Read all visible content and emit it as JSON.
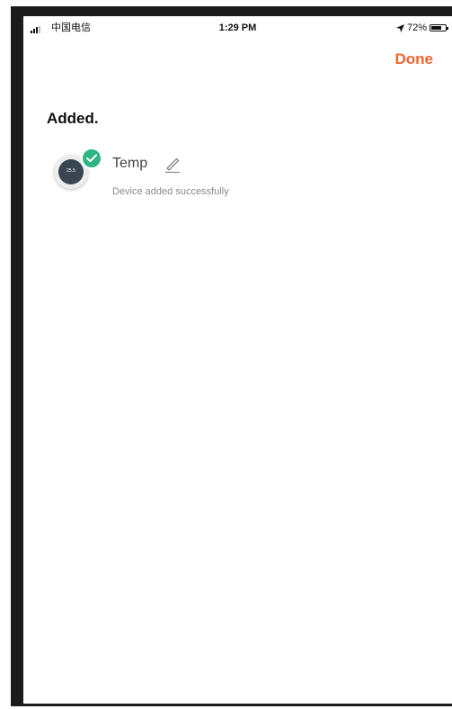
{
  "status_bar": {
    "carrier": "中国电信",
    "time": "1:29 PM",
    "battery_text": "72%",
    "battery_level": 0.72,
    "icons": [
      "signal-icon",
      "location-arrow-icon",
      "battery-icon"
    ]
  },
  "nav": {
    "done_label": "Done"
  },
  "section": {
    "title": "Added."
  },
  "devices": [
    {
      "name": "Temp",
      "status": "Device added successfully",
      "thumb_reading": "25.5",
      "icons": [
        "thermostat-device-icon",
        "check-badge-icon",
        "edit-pencil-icon"
      ]
    }
  ],
  "colors": {
    "accent": "#f0642c",
    "success": "#2db581",
    "title_text": "#111111",
    "secondary_text": "#8a8a8a"
  }
}
